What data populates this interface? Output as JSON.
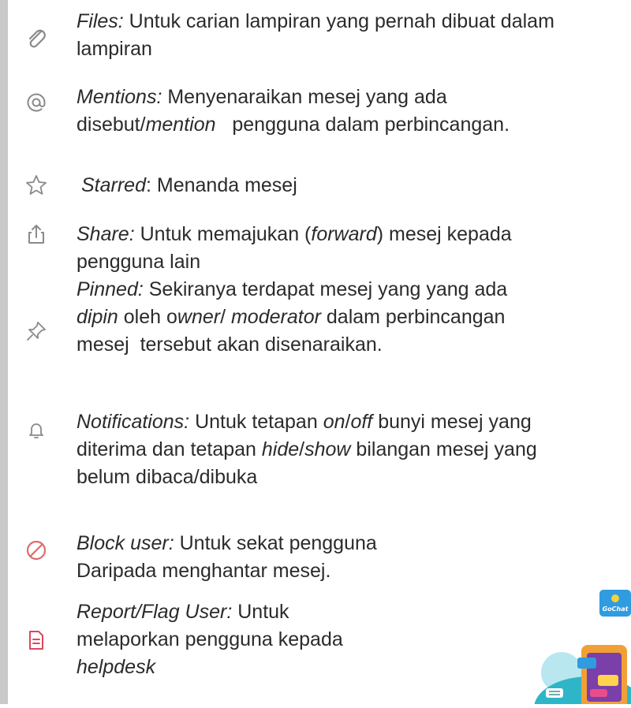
{
  "items": [
    {
      "id": "files",
      "icon": "paperclip-icon",
      "lines": [
        [
          {
            "t": "Files:",
            "i": true
          },
          {
            "t": " Untuk carian lampiran yang pernah dibuat dalam",
            "i": false
          }
        ],
        [
          {
            "t": "lampiran",
            "i": false
          }
        ]
      ]
    },
    {
      "id": "mentions",
      "icon": "at-sign-icon",
      "lines": [
        [
          {
            "t": "Mentions:",
            "i": true
          },
          {
            "t": " Menyenaraikan mesej yang ada",
            "i": false
          }
        ],
        [
          {
            "t": "disebut/",
            "i": false
          },
          {
            "t": "mention",
            "i": true
          },
          {
            "t": "   pengguna dalam perbincangan.",
            "i": false
          }
        ]
      ]
    },
    {
      "id": "starred",
      "icon": "star-icon",
      "lines": [
        [
          {
            "t": "Starred",
            "i": true
          },
          {
            "t": ": Menanda mesej",
            "i": false
          }
        ]
      ]
    },
    {
      "id": "share",
      "icon": "share-icon",
      "lines": [
        [
          {
            "t": "Share:",
            "i": true
          },
          {
            "t": " Untuk memajukan (",
            "i": false
          },
          {
            "t": "forward",
            "i": true
          },
          {
            "t": ") mesej kepada",
            "i": false
          }
        ],
        [
          {
            "t": "pengguna lain",
            "i": false
          }
        ]
      ]
    },
    {
      "id": "pinned",
      "icon": "pin-icon",
      "lines": [
        [
          {
            "t": "Pinned:",
            "i": true
          },
          {
            "t": " Sekiranya terdapat mesej yang yang ada",
            "i": false
          }
        ],
        [
          {
            "t": "dipin",
            "i": true
          },
          {
            "t": " oleh o",
            "i": false
          },
          {
            "t": "wner",
            "i": true
          },
          {
            "t": "/ ",
            "i": false
          },
          {
            "t": "moderator",
            "i": true
          },
          {
            "t": " dalam perbincangan",
            "i": false
          }
        ],
        [
          {
            "t": "mesej  tersebut akan disenaraikan.",
            "i": false
          }
        ]
      ]
    },
    {
      "id": "notifications",
      "icon": "bell-icon",
      "lines": [
        [
          {
            "t": "Notifications:",
            "i": true
          },
          {
            "t": " Untuk tetapan ",
            "i": false
          },
          {
            "t": "on",
            "i": true
          },
          {
            "t": "/",
            "i": false
          },
          {
            "t": "off",
            "i": true
          },
          {
            "t": " bunyi mesej yang",
            "i": false
          }
        ],
        [
          {
            "t": "diterima dan tetapan ",
            "i": false
          },
          {
            "t": "hide",
            "i": true
          },
          {
            "t": "/",
            "i": false
          },
          {
            "t": "show",
            "i": true
          },
          {
            "t": " bilangan mesej yang",
            "i": false
          }
        ],
        [
          {
            "t": "belum dibaca/dibuka",
            "i": false
          }
        ]
      ]
    },
    {
      "id": "block",
      "icon": "block-icon",
      "lines": [
        [
          {
            "t": "Block user:",
            "i": true
          },
          {
            "t": " Untuk sekat pengguna",
            "i": false
          }
        ],
        [
          {
            "t": "Daripada menghantar mesej.",
            "i": false
          }
        ]
      ]
    },
    {
      "id": "report",
      "icon": "report-document-icon",
      "lines": [
        [
          {
            "t": "Report/Flag User:",
            "i": true
          },
          {
            "t": " Untuk",
            "i": false
          }
        ],
        [
          {
            "t": "melaporkan pengguna kepada",
            "i": false
          }
        ],
        [
          {
            "t": "helpdesk",
            "i": true
          }
        ]
      ]
    }
  ],
  "illustration": {
    "badge_text": "GoChat"
  },
  "colors": {
    "icon_gray": "#8a8a8a",
    "block_red": "#e06a6a",
    "report_red": "#e0455a",
    "sidebar": "#c9c9c9"
  }
}
